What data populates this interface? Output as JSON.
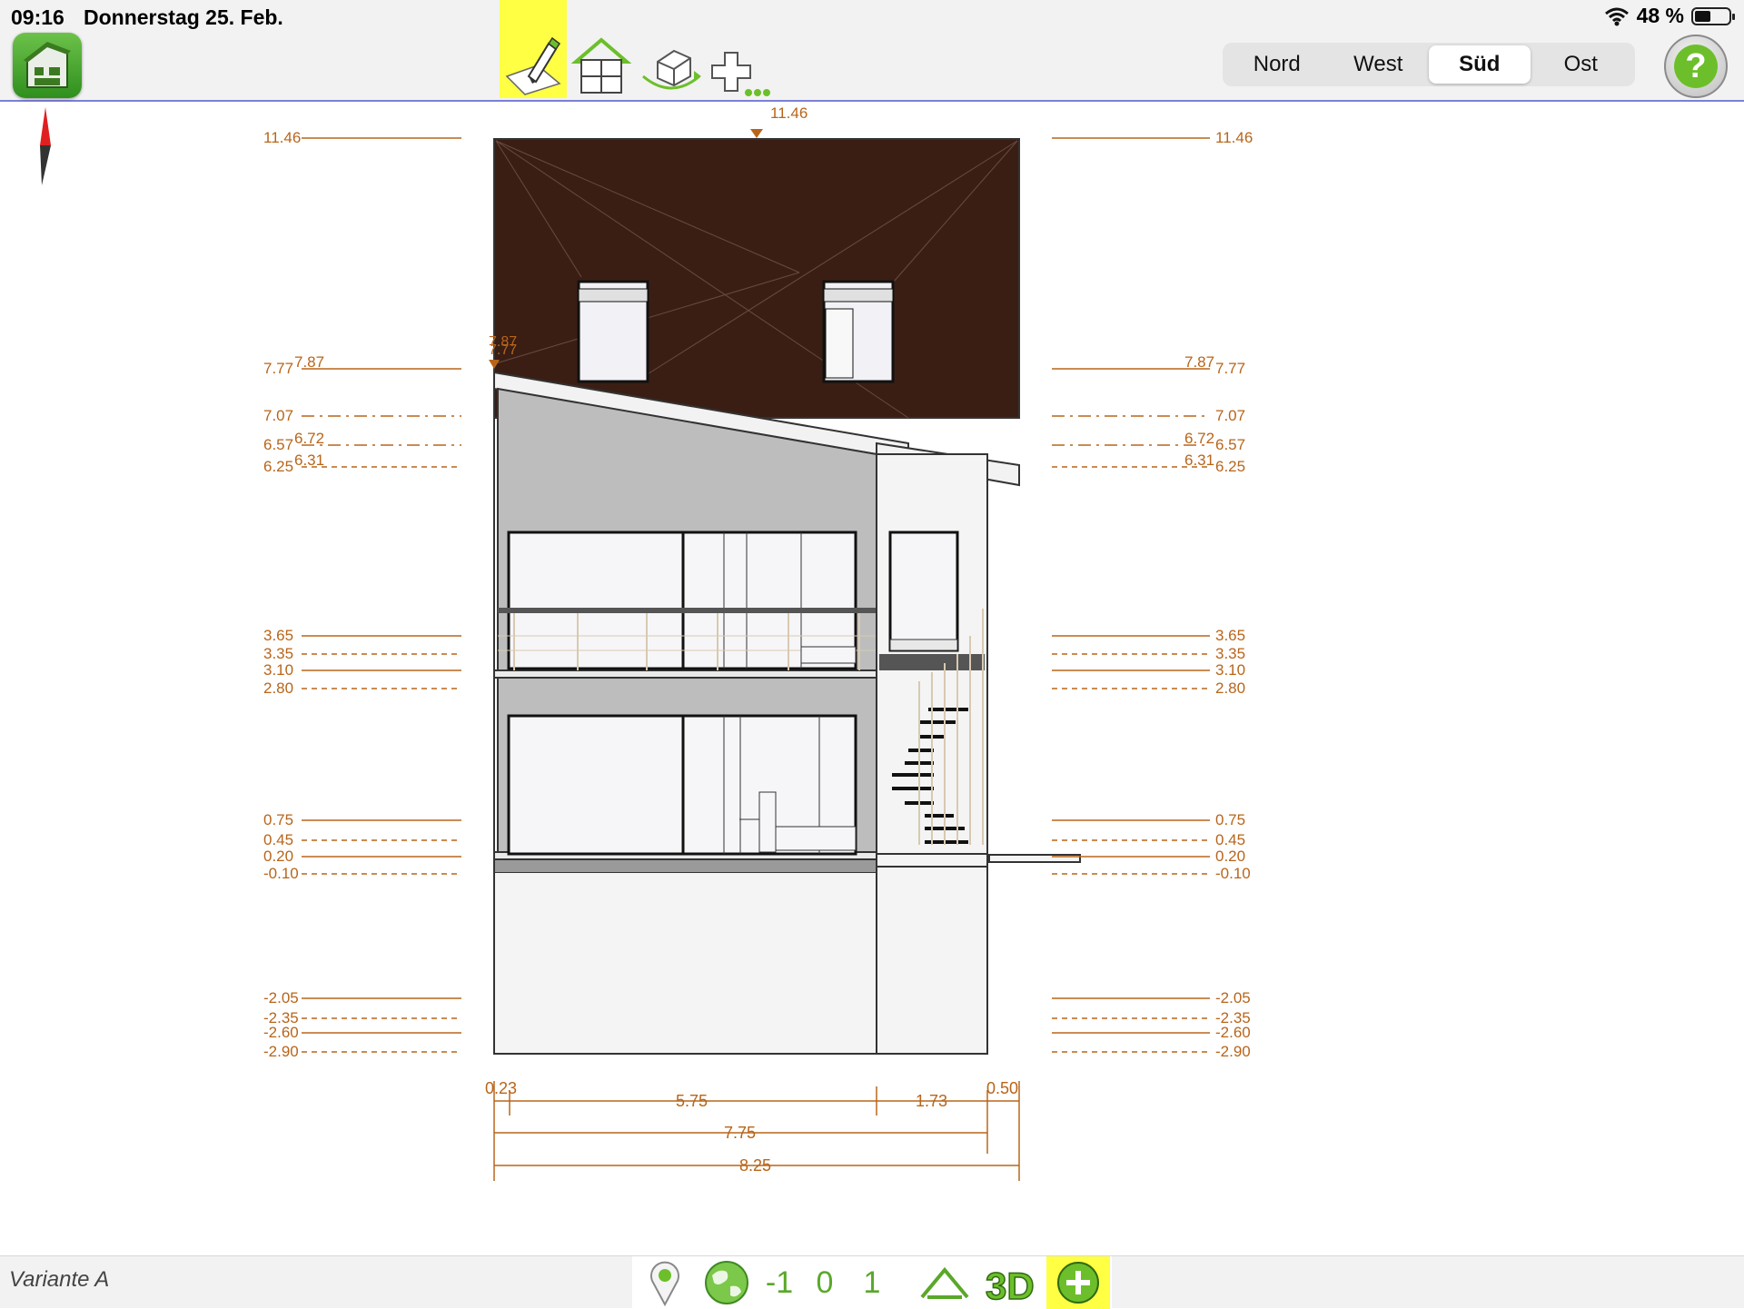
{
  "status_bar": {
    "time": "09:16",
    "date": "Donnerstag 25. Feb.",
    "battery": "48 %",
    "battery_level": 0.48
  },
  "toolbar": {
    "tools": [
      {
        "icon": "edit-pencil-icon",
        "active": true
      },
      {
        "icon": "floorplan-house-icon",
        "active": false
      },
      {
        "icon": "rotate-3d-house-icon",
        "active": false
      },
      {
        "icon": "add-more-icon",
        "active": false
      }
    ],
    "views": [
      "Nord",
      "West",
      "Süd",
      "Ost"
    ],
    "selected_view": "Süd",
    "help_label": "?"
  },
  "drawing": {
    "top_label": "11.46",
    "left_levels": [
      {
        "label": "11.46",
        "style": "solid"
      },
      {
        "label": "7.77",
        "label2": "7.87",
        "style": "solid"
      },
      {
        "label": "7.07",
        "style": "dashdot"
      },
      {
        "label": "6.57",
        "label2": "6.72",
        "style": "dashdot"
      },
      {
        "label": "6.25",
        "label2": "6.31",
        "style": "dashed"
      },
      {
        "label": "3.65",
        "style": "solid"
      },
      {
        "label": "3.35",
        "style": "dashed"
      },
      {
        "label": "3.10",
        "style": "solid"
      },
      {
        "label": "2.80",
        "style": "dashed"
      },
      {
        "label": "0.75",
        "style": "solid"
      },
      {
        "label": "0.45",
        "style": "dashed"
      },
      {
        "label": "0.20",
        "style": "solid"
      },
      {
        "label": "-0.10",
        "style": "dashed"
      },
      {
        "label": "-2.05",
        "style": "solid"
      },
      {
        "label": "-2.35",
        "style": "dashed"
      },
      {
        "label": "-2.60",
        "style": "solid"
      },
      {
        "label": "-2.90",
        "style": "dashed"
      }
    ],
    "right_levels": [
      {
        "label": "11.46"
      },
      {
        "label": "7.77",
        "label2": "7.87"
      },
      {
        "label": "7.07"
      },
      {
        "label": "6.57",
        "label2": "6.72"
      },
      {
        "label": "6.25",
        "label2": "6.31"
      },
      {
        "label": "3.65"
      },
      {
        "label": "3.35"
      },
      {
        "label": "3.10"
      },
      {
        "label": "2.80"
      },
      {
        "label": "0.75"
      },
      {
        "label": "0.45"
      },
      {
        "label": "0.20"
      },
      {
        "label": "-0.10"
      },
      {
        "label": "-2.05"
      },
      {
        "label": "-2.35"
      },
      {
        "label": "-2.60"
      },
      {
        "label": "-2.90"
      }
    ],
    "eave_marker": {
      "label_a": "7.87",
      "label_b": "7.77"
    },
    "dimensions": {
      "row1": [
        "0.23",
        "5.75",
        "1.73",
        "0.50"
      ],
      "row2": "7.75",
      "row3": "8.25"
    },
    "colors": {
      "dim": "#b8651a",
      "roof": "#3a1e14",
      "wall_grey": "#bdbdbd"
    }
  },
  "bottom_bar": {
    "variant": "Variante A",
    "levels": [
      "-1",
      "0",
      "1"
    ],
    "icons": [
      "location-pin-icon",
      "globe-icon",
      "house-outline-icon",
      "3d-icon",
      "add-circle-icon"
    ]
  }
}
